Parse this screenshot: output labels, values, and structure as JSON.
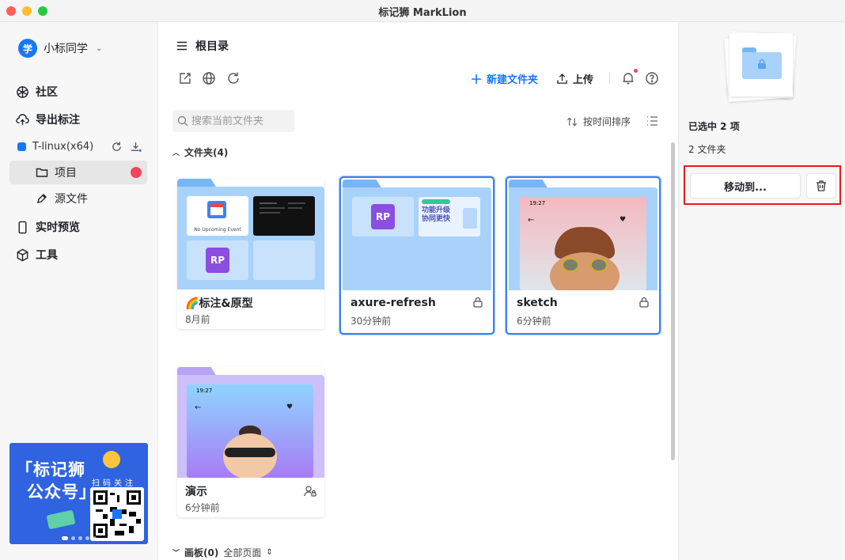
{
  "window": {
    "title": "标记狮 MarkLion"
  },
  "sidebar": {
    "user": {
      "avatar_text": "学",
      "name": "小标同学"
    },
    "nav": [
      {
        "label": "社区",
        "icon": "globe-grid-icon"
      },
      {
        "label": "导出标注",
        "icon": "cloud-upload-icon"
      }
    ],
    "team": {
      "name": "T-linux(x64)"
    },
    "subnav": [
      {
        "label": "项目",
        "icon": "folder-icon",
        "active": true
      },
      {
        "label": "源文件",
        "icon": "pen-icon"
      }
    ],
    "nav2": [
      {
        "label": "实时预览",
        "icon": "phone-icon"
      },
      {
        "label": "工具",
        "icon": "cube-icon"
      }
    ],
    "banner": {
      "title_line1": "「标记狮",
      "title_line2": "公众号」",
      "scan_text": "扫码关注"
    }
  },
  "main": {
    "breadcrumb": "根目录",
    "toolbar": {
      "new_folder": "新建文件夹",
      "upload": "上传"
    },
    "search": {
      "placeholder": "搜索当前文件夹"
    },
    "sort": {
      "label": "按时间排序"
    },
    "folders_section": "文件夹(4)",
    "boards_section": {
      "label": "画板(0)",
      "filter": "全部页面"
    },
    "folders": [
      {
        "name": "🌈标注&原型",
        "time": "8月前",
        "selected": false,
        "event_text": "No Upcoming Event"
      },
      {
        "name": "axure-refresh",
        "time": "30分钟前",
        "selected": true,
        "locked": true,
        "promo_line1": "功能升级",
        "promo_line2": "协同更快"
      },
      {
        "name": "sketch",
        "time": "6分钟前",
        "selected": true,
        "locked": true,
        "status_time": "19:27"
      },
      {
        "name": "演示",
        "time": "6分钟前",
        "selected": false,
        "shared": true,
        "status_time": "19:27"
      }
    ]
  },
  "panel": {
    "selected_title": "已选中 2 项",
    "selected_sub": "2 文件夹",
    "move_label": "移动到...",
    "delete_icon": "trash-icon"
  }
}
